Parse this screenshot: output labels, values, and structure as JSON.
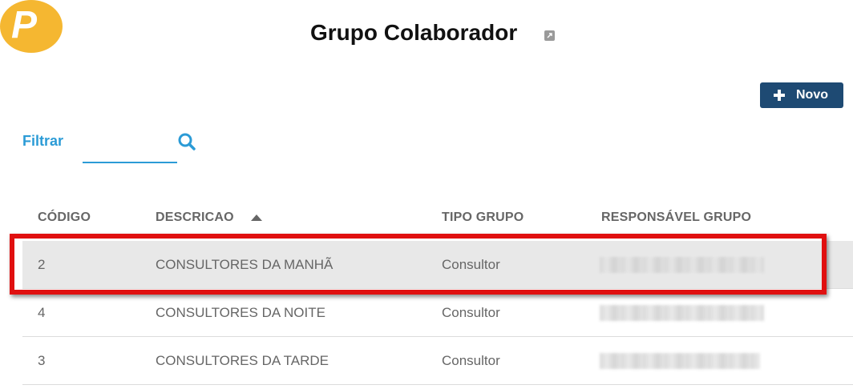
{
  "logo": {
    "letter": "P"
  },
  "header": {
    "title": "Grupo Colaborador",
    "title_icon": "external-link-icon"
  },
  "toolbar": {
    "new_label": "Novo",
    "new_icon": "plus-icon"
  },
  "filter": {
    "label": "Filtrar",
    "value": "",
    "placeholder": "",
    "icon": "search-icon",
    "accent_color": "#2b9bd6"
  },
  "table": {
    "columns": [
      {
        "label": "CÓDIGO"
      },
      {
        "label": "DESCRICAO",
        "sort": "ascending"
      },
      {
        "label": "TIPO GRUPO"
      },
      {
        "label": "RESPONSÁVEL GRUPO"
      }
    ],
    "rows": [
      {
        "codigo": "2",
        "descricao": "CONSULTORES DA MANHÃ",
        "tipo": "Consultor",
        "responsavel_redacted": true,
        "highlighted": true
      },
      {
        "codigo": "4",
        "descricao": "CONSULTORES DA NOITE",
        "tipo": "Consultor",
        "responsavel_redacted": true,
        "highlighted": false
      },
      {
        "codigo": "3",
        "descricao": "CONSULTORES DA TARDE",
        "tipo": "Consultor",
        "responsavel_redacted": true,
        "highlighted": false
      }
    ]
  },
  "colors": {
    "brand_yellow": "#f5b731",
    "button_navy": "#1e4a73",
    "highlight_red": "#e01010"
  }
}
